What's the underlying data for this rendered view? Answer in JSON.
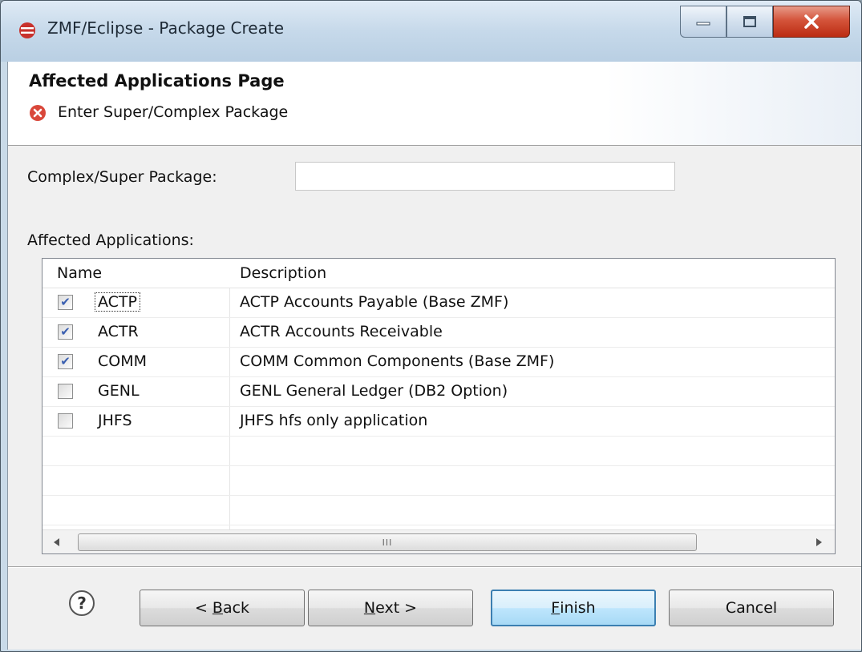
{
  "window": {
    "title": "ZMF/Eclipse - Package Create",
    "icon": "zmf-eclipse-icon",
    "controls": {
      "minimize": "minimize-icon",
      "maximize": "maximize-icon",
      "close": "close-icon"
    }
  },
  "header": {
    "page_title": "Affected Applications Page",
    "error_icon": "error-icon",
    "error_message": "Enter Super/Complex Package"
  },
  "form": {
    "super_package_label": "Complex/Super Package:",
    "super_package_value": "",
    "affected_label": "Affected Applications:"
  },
  "table": {
    "columns": [
      "Name",
      "Description"
    ],
    "rows": [
      {
        "name": "ACTP",
        "description": "ACTP Accounts Payable (Base ZMF)",
        "checked": true,
        "focused": true
      },
      {
        "name": "ACTR",
        "description": "ACTR Accounts Receivable",
        "checked": true,
        "focused": false
      },
      {
        "name": "COMM",
        "description": "COMM Common Components (Base ZMF)",
        "checked": true,
        "focused": false
      },
      {
        "name": "GENL",
        "description": "GENL General Ledger (DB2 Option)",
        "checked": false,
        "focused": false
      },
      {
        "name": "JHFS",
        "description": "JHFS hfs only application",
        "checked": false,
        "focused": false
      },
      {
        "name": "",
        "description": "",
        "checked": null,
        "focused": false
      },
      {
        "name": "",
        "description": "",
        "checked": null,
        "focused": false
      },
      {
        "name": "",
        "description": "",
        "checked": null,
        "focused": false
      }
    ],
    "scrollbar_grip": "III"
  },
  "buttons": {
    "help_glyph": "?",
    "back_prefix": "< ",
    "back_mnemonic": "B",
    "back_rest": "ack",
    "next_mnemonic": "N",
    "next_rest": "ext >",
    "finish_mnemonic": "F",
    "finish_rest": "inish",
    "cancel": "Cancel"
  },
  "colors": {
    "default_button_border": "#3c7fb1",
    "checkbox_mark": "#3a5fb0",
    "error_icon": "#d9473a",
    "app_icon": "#c8312c"
  }
}
